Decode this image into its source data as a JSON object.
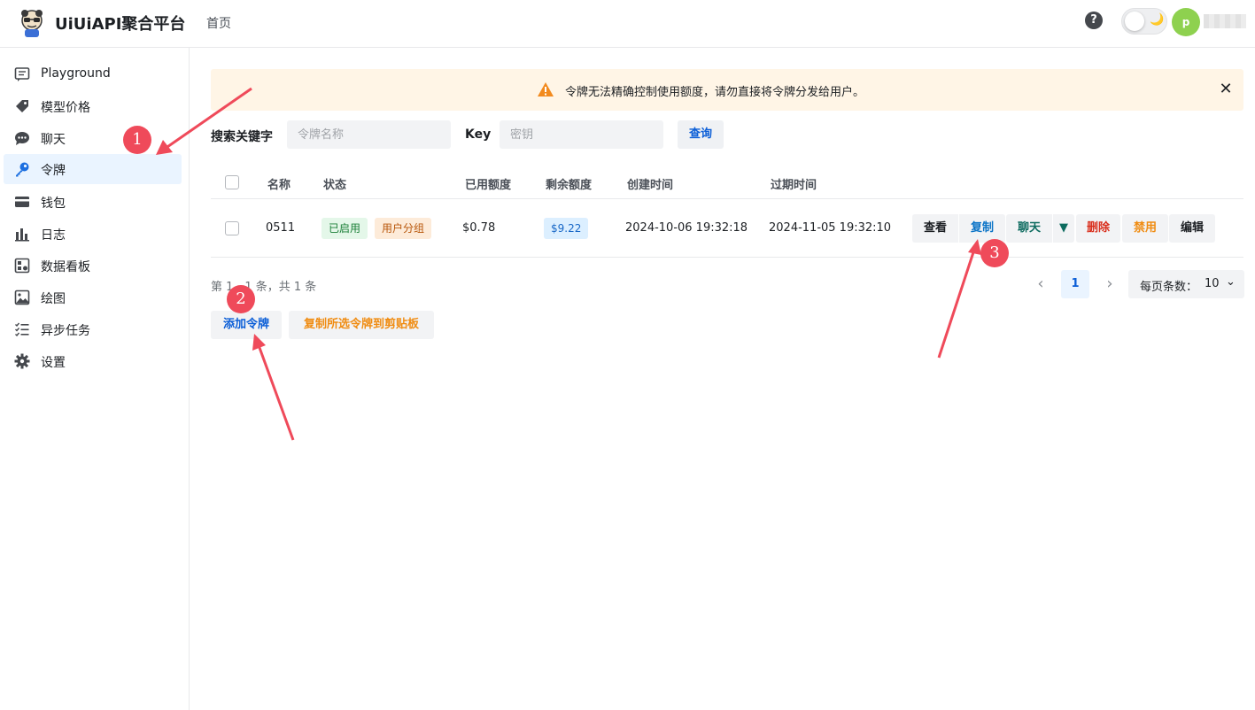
{
  "header": {
    "brand": "UiUiAPI聚合平台",
    "nav_home": "首页",
    "help_glyph": "?",
    "moon_glyph": "🌙",
    "avatar_letter": "p"
  },
  "sidebar": {
    "items": [
      {
        "label": "Playground",
        "icon": "chat-square-icon"
      },
      {
        "label": "模型价格",
        "icon": "price-tag-icon"
      },
      {
        "label": "聊天",
        "icon": "chat-bubble-icon"
      },
      {
        "label": "令牌",
        "icon": "key-icon"
      },
      {
        "label": "钱包",
        "icon": "wallet-card-icon"
      },
      {
        "label": "日志",
        "icon": "bar-chart-icon"
      },
      {
        "label": "数据看板",
        "icon": "dashboard-icon"
      },
      {
        "label": "绘图",
        "icon": "image-icon"
      },
      {
        "label": "异步任务",
        "icon": "task-list-icon"
      },
      {
        "label": "设置",
        "icon": "gear-icon"
      }
    ],
    "active_index": 3
  },
  "banner": {
    "text": "令牌无法精确控制使用额度，请勿直接将令牌分发给用户。",
    "close_glyph": "✕"
  },
  "search": {
    "keyword_label": "搜索关键字",
    "name_placeholder": "令牌名称",
    "key_label": "Key",
    "key_placeholder": "密钥",
    "query_label": "查询"
  },
  "table": {
    "columns": [
      "名称",
      "状态",
      "已用额度",
      "剩余额度",
      "创建时间",
      "过期时间"
    ],
    "rows": [
      {
        "name": "0511",
        "status": "已启用",
        "group": "用户分组",
        "used": "$0.78",
        "remaining": "$9.22",
        "created": "2024-10-06 19:32:18",
        "expires": "2024-11-05 19:32:10",
        "actions": {
          "view": "查看",
          "copy": "复制",
          "chat": "聊天",
          "caret": "▼",
          "delete": "删除",
          "disable": "禁用",
          "edit": "编辑"
        }
      }
    ]
  },
  "pagination": {
    "info": "第 1 - 1 条，共 1 条",
    "prev_glyph": "‹",
    "next_glyph": "›",
    "current_page": "1",
    "per_page_label": "每页条数：",
    "per_page_value": "10",
    "caret_glyph": "⌄"
  },
  "bottom_actions": {
    "add_label": "添加令牌",
    "copy_selected_label": "复制所选令牌到剪贴板"
  },
  "annotations": {
    "badges": [
      "1",
      "2",
      "3"
    ],
    "color": "#ef4a5a"
  }
}
